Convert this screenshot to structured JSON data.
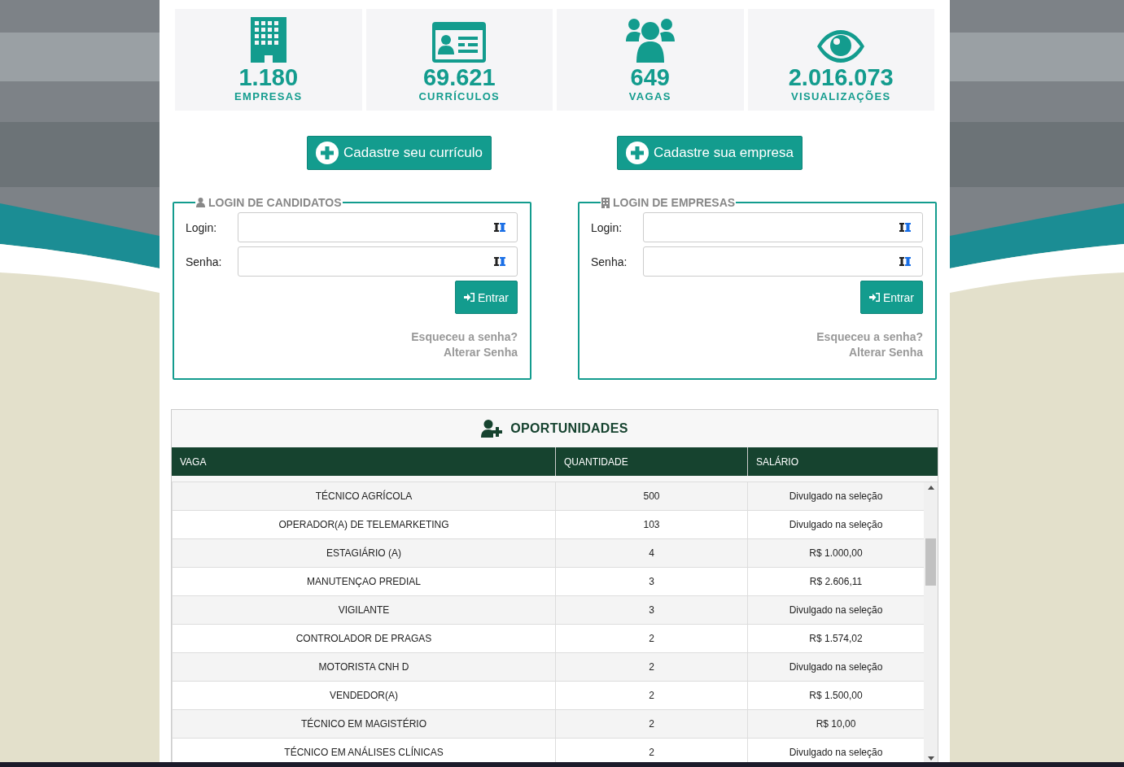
{
  "stats": [
    {
      "kind": "building",
      "value": "1.180",
      "label": "EMPRESAS"
    },
    {
      "kind": "id-card",
      "value": "69.621",
      "label": "CURRÍCULOS"
    },
    {
      "kind": "users",
      "value": "649",
      "label": "VAGAS"
    },
    {
      "kind": "eye",
      "value": "2.016.073",
      "label": "VISUALIZAÇÕES"
    }
  ],
  "signup_buttons": [
    "Cadastre seu currículo",
    "Cadastre sua empresa"
  ],
  "login_panels": [
    {
      "kind": "candidate",
      "title": "LOGIN DE CANDIDATOS",
      "fields": [
        {
          "label": "Login:"
        },
        {
          "label": "Senha:"
        }
      ],
      "submit": "Entrar",
      "forgot": "Esqueceu a senha?",
      "change": "Alterar Senha"
    },
    {
      "kind": "company",
      "title": "LOGIN DE EMPRESAS",
      "fields": [
        {
          "label": "Login:"
        },
        {
          "label": "Senha:"
        }
      ],
      "submit": "Entrar",
      "forgot": "Esqueceu a senha?",
      "change": "Alterar Senha"
    }
  ],
  "opportunities": {
    "title": "OPORTUNIDADES",
    "columns": [
      "VAGA",
      "QUANTIDADE",
      "SALÁRIO"
    ],
    "rows": [
      [
        "TÉCNICO AGRÍCOLA",
        "500",
        "Divulgado na seleção"
      ],
      [
        "OPERADOR(A) DE TELEMARKETING",
        "103",
        "Divulgado na seleção"
      ],
      [
        "ESTAGIÁRIO (A)",
        "4",
        "R$ 1.000,00"
      ],
      [
        "MANUTENÇAO PREDIAL",
        "3",
        "R$ 2.606,11"
      ],
      [
        "VIGILANTE",
        "3",
        "Divulgado na seleção"
      ],
      [
        "CONTROLADOR DE PRAGAS",
        "2",
        "R$ 1.574,02"
      ],
      [
        "MOTORISTA CNH D",
        "2",
        "Divulgado na seleção"
      ],
      [
        "VENDEDOR(A)",
        "2",
        "R$ 1.500,00"
      ],
      [
        "TÉCNICO EM MAGISTÉRIO",
        "2",
        "R$ 10,00"
      ],
      [
        "TÉCNICO EM ANÁLISES CLÍNICAS",
        "2",
        "Divulgado na seleção"
      ]
    ]
  }
}
